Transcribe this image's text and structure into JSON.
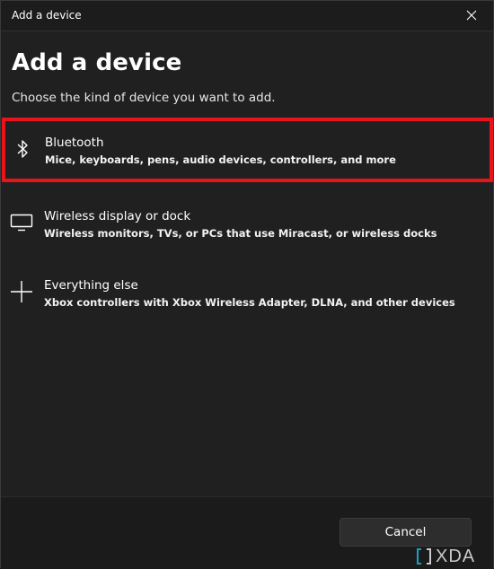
{
  "window": {
    "title": "Add a device"
  },
  "page": {
    "title": "Add a device",
    "subtitle": "Choose the kind of device you want to add."
  },
  "options": [
    {
      "icon": "bluetooth-icon",
      "title": "Bluetooth",
      "description": "Mice, keyboards, pens, audio devices, controllers, and more",
      "highlighted": true
    },
    {
      "icon": "monitor-icon",
      "title": "Wireless display or dock",
      "description": "Wireless monitors, TVs, or PCs that use Miracast, or wireless docks",
      "highlighted": false
    },
    {
      "icon": "plus-icon",
      "title": "Everything else",
      "description": "Xbox controllers with Xbox Wireless Adapter, DLNA, and other devices",
      "highlighted": false
    }
  ],
  "footer": {
    "cancel_label": "Cancel"
  },
  "watermark": {
    "text": "XDA"
  },
  "colors": {
    "background": "#202020",
    "highlight_border": "#e8141b",
    "button": "#2d2d2d"
  }
}
